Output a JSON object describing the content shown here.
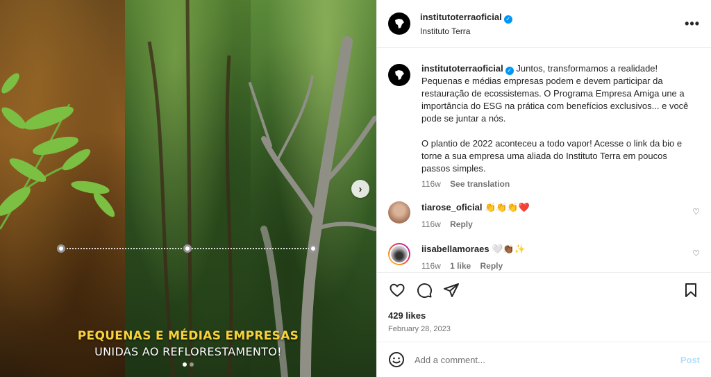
{
  "post": {
    "username": "institutoterraoficial",
    "subtitle": "Instituto Terra",
    "more_label": "•••"
  },
  "media": {
    "caption_line1": "PEQUENAS E MÉDIAS EMPRESAS",
    "caption_line2": "UNIDAS AO REFLORESTAMENTO!",
    "next_icon": "chevron-right-icon",
    "carousel_active_index": 0,
    "carousel_count": 2
  },
  "caption": {
    "author": "institutoterraoficial",
    "paragraph1": "Juntos, transformamos a realidade! Pequenas e médias empresas podem e devem participar da restauração de ecossistemas. O Programa Empresa Amiga une a importância do ESG na prática com benefícios exclusivos... e você pode se juntar a nós.",
    "paragraph2": "O plantio de 2022 aconteceu a todo vapor! Acesse o link da bio e torne a sua empresa uma aliada do Instituto Terra em poucos passos simples.",
    "time": "116w",
    "see_translation": "See translation"
  },
  "comments": [
    {
      "author": "tiarose_oficial",
      "text": "👏👏👏❤️",
      "time": "116w",
      "reply": "Reply"
    },
    {
      "author": "iisabellamoraes",
      "text": "🤍👏🏾✨",
      "time": "116w",
      "likes": "1 like",
      "reply": "Reply"
    }
  ],
  "actions": {
    "likes": "429 likes",
    "date": "February 28, 2023"
  },
  "composer": {
    "placeholder": "Add a comment...",
    "post_label": "Post"
  },
  "colors": {
    "verified": "#0095f6",
    "caption_yellow": "#f7d23b",
    "post_disabled": "#b2dffc"
  }
}
